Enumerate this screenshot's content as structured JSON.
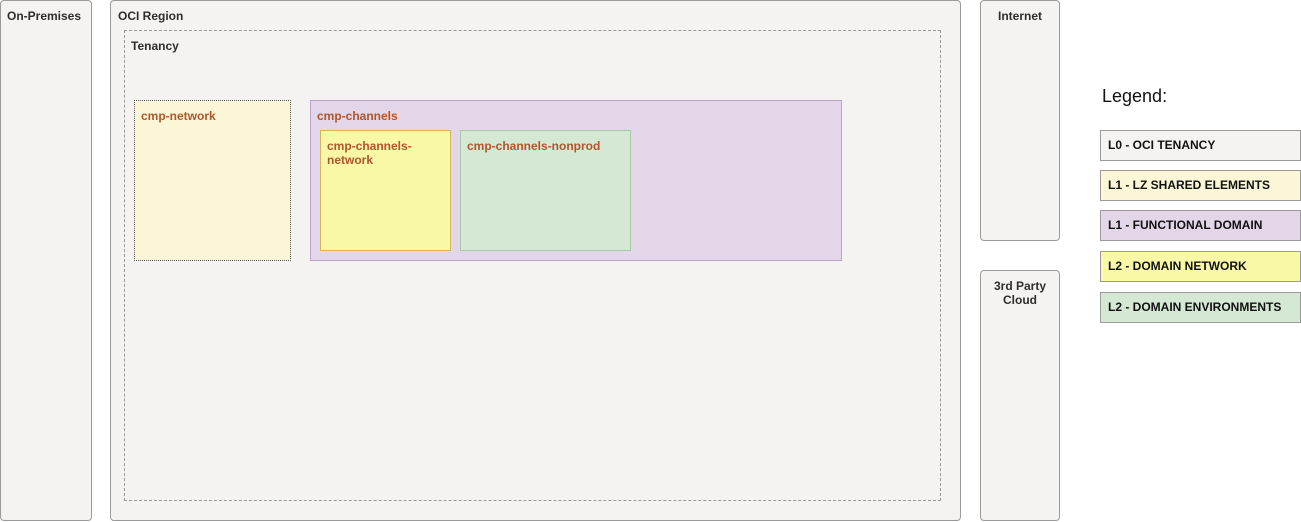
{
  "zones": {
    "on_premises": "On-Premises",
    "oci_region": "OCI Region",
    "tenancy": "Tenancy",
    "internet": "Internet",
    "third_party_cloud": "3rd Party Cloud"
  },
  "compartments": {
    "network": "cmp-network",
    "channels": "cmp-channels",
    "channels_network": "cmp-channels-network",
    "channels_nonprod": "cmp-channels-nonprod"
  },
  "legend": {
    "title": "Legend:",
    "items": [
      {
        "label": "L0 - OCI TENANCY",
        "color": "#f4f3f1"
      },
      {
        "label": "L1 - LZ SHARED ELEMENTS",
        "color": "#fbf7d6"
      },
      {
        "label": "L1 - FUNCTIONAL DOMAIN",
        "color": "#e2d6e8"
      },
      {
        "label": "L2 - DOMAIN NETWORK",
        "color": "#f8f8a6"
      },
      {
        "label": "L2 - DOMAIN ENVIRONMENTS",
        "color": "#d5e8d4"
      }
    ]
  },
  "colors": {
    "compartment_label": "#ae562c",
    "zone_background": "#f4f3f1"
  }
}
